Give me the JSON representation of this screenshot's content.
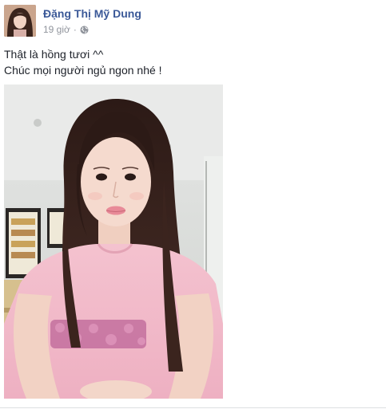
{
  "post": {
    "author_name": "Đặng Thị Mỹ Dung",
    "timestamp": "19 giờ",
    "separator": "·",
    "privacy_icon": "globe-icon",
    "text_lines": [
      "Thật là hồng tươi ^^",
      "Chúc mọi người ngủ ngon nhé !"
    ],
    "photo_alt": "selfie-photo"
  },
  "colors": {
    "author_link": "#3b5998",
    "meta_text": "#90949c",
    "body_text": "#1d2129",
    "shirt_pink": "#f2b8c6"
  }
}
